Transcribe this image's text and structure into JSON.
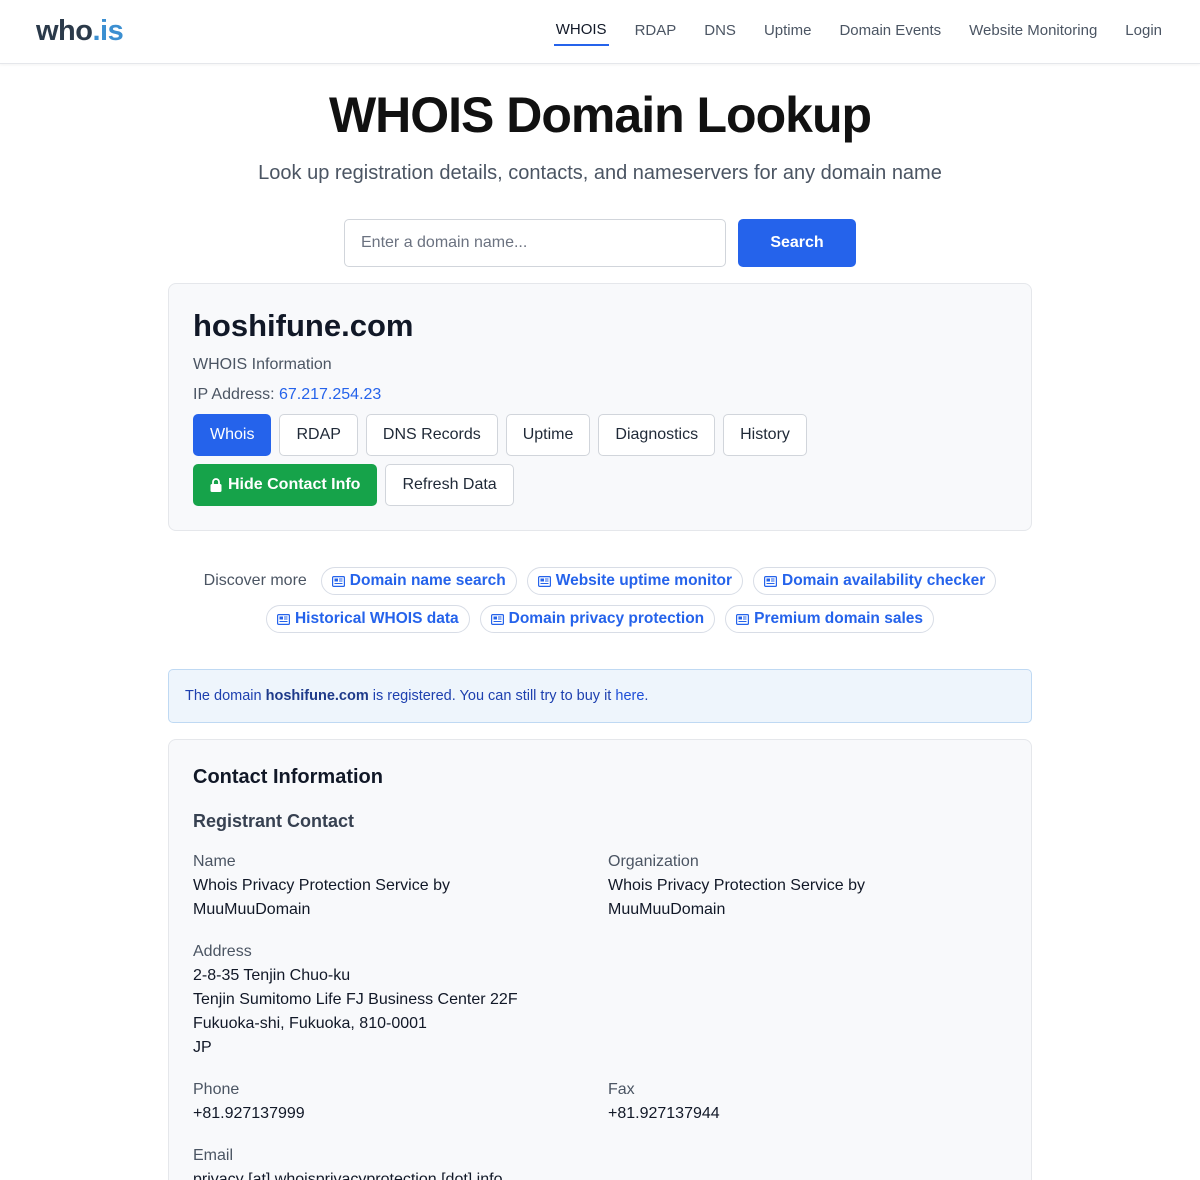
{
  "header": {
    "logo_main": "who",
    "logo_tld": ".is",
    "nav": [
      {
        "label": "WHOIS"
      },
      {
        "label": "RDAP"
      },
      {
        "label": "DNS"
      },
      {
        "label": "Uptime"
      },
      {
        "label": "Domain Events"
      },
      {
        "label": "Website Monitoring"
      },
      {
        "label": "Login"
      }
    ]
  },
  "hero": {
    "title": "WHOIS Domain Lookup",
    "subtitle": "Look up registration details, contacts, and nameservers for any domain name"
  },
  "search": {
    "placeholder": "Enter a domain name...",
    "value": "",
    "button_label": "Search"
  },
  "domain": {
    "name": "hoshifune.com",
    "info_label": "WHOIS Information",
    "ip_label": "IP Address:",
    "ip_value": "67.217.254.23",
    "tabs": [
      {
        "label": "Whois"
      },
      {
        "label": "RDAP"
      },
      {
        "label": "DNS Records"
      },
      {
        "label": "Uptime"
      },
      {
        "label": "Diagnostics"
      },
      {
        "label": "History"
      }
    ],
    "hide_contact_label": "Hide Contact Info",
    "refresh_label": "Refresh Data"
  },
  "discover": {
    "label": "Discover more",
    "links": [
      {
        "label": "Domain name search"
      },
      {
        "label": "Website uptime monitor"
      },
      {
        "label": "Domain availability checker"
      },
      {
        "label": "Historical WHOIS data"
      },
      {
        "label": "Domain privacy protection"
      },
      {
        "label": "Premium domain sales"
      }
    ]
  },
  "notice": {
    "prefix": "The domain",
    "domain": "hoshifune.com",
    "middle": "is registered. You can still try to buy it",
    "link": "here",
    "suffix": "."
  },
  "contact": {
    "title": "Contact Information",
    "section": "Registrant Contact",
    "name_label": "Name",
    "name_line1": "Whois Privacy Protection Service by",
    "name_line2": "MuuMuuDomain",
    "org_label": "Organization",
    "org_line1": "Whois Privacy Protection Service by",
    "org_line2": "MuuMuuDomain",
    "address_label": "Address",
    "address_lines": [
      "2-8-35 Tenjin Chuo-ku",
      "Tenjin Sumitomo Life FJ Business Center 22F",
      "Fukuoka-shi, Fukuoka, 810-0001",
      "JP"
    ],
    "phone_label": "Phone",
    "phone_value": "+81.927137999",
    "fax_label": "Fax",
    "fax_value": "+81.927137944",
    "email_label": "Email",
    "email_value": "privacy [at] whoisprivacyprotection [dot] info"
  },
  "colors": {
    "accent": "#2563eb",
    "success": "#16a34a",
    "logo_tld": "#3b8fd1",
    "notice_bg": "#eef5fc"
  }
}
